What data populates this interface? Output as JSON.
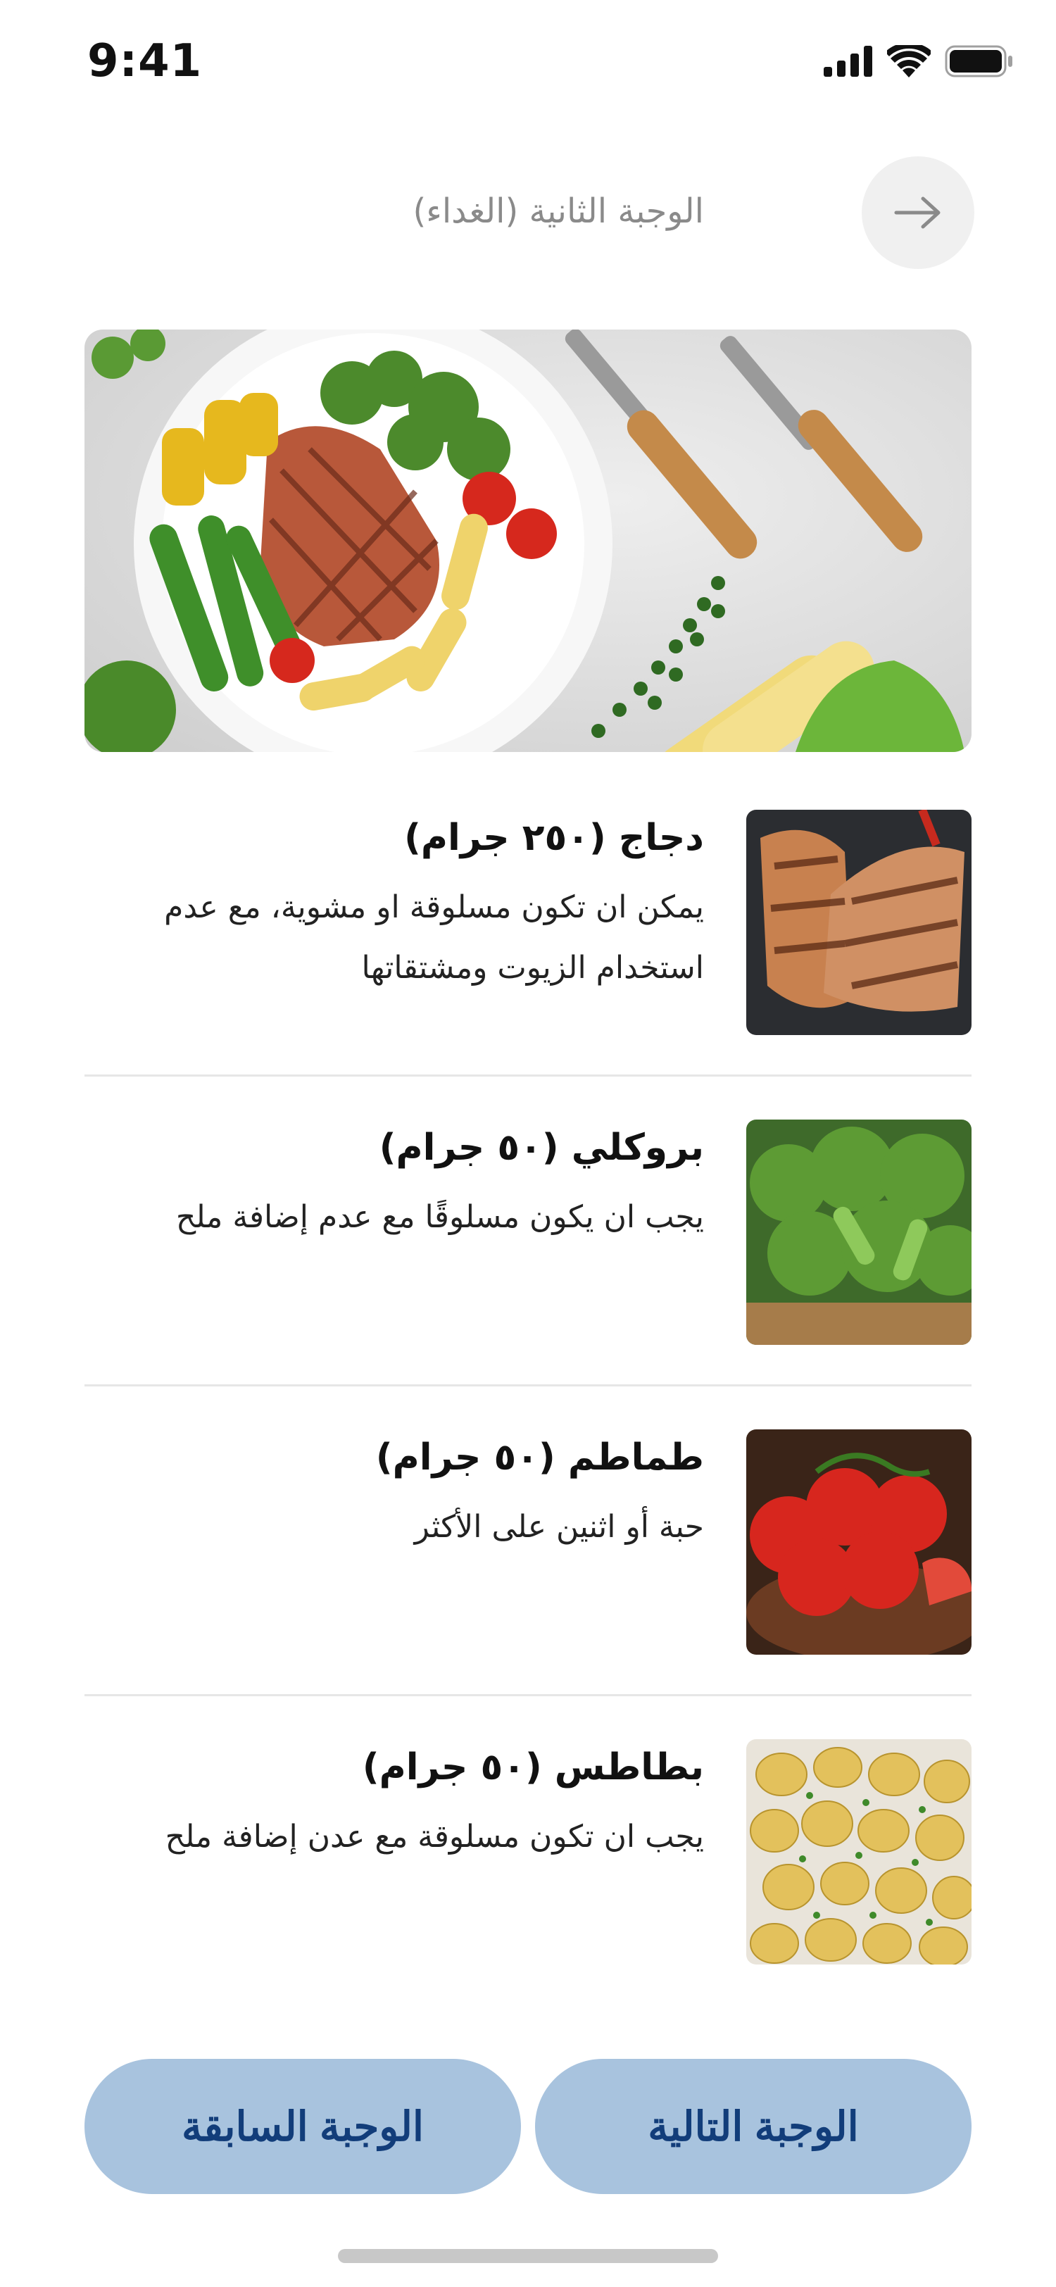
{
  "status_bar": {
    "time": "9:41"
  },
  "header": {
    "title": "الوجبة الثانية (الغداء)"
  },
  "food_items": [
    {
      "name": "دجاج (٢٥٠ جرام)",
      "description": "يمكن ان تكون مسلوقة او مشوية، مع عدم استخدام الزيوت ومشتقاتها"
    },
    {
      "name": "بروكلي (٥٠ جرام)",
      "description": "يجب ان يكون مسلوقًا مع عدم إضافة ملح"
    },
    {
      "name": "طماطم (٥٠ جرام)",
      "description": "حبة أو اثنين على الأكثر"
    },
    {
      "name": "بطاطس (٥٠ جرام)",
      "description": "يجب ان تكون مسلوقة مع عدن إضافة ملح"
    }
  ],
  "footer": {
    "next_label": "الوجبة التالية",
    "previous_label": "الوجبة السابقة"
  },
  "colors": {
    "button_bg": "#a8c3de",
    "button_text": "#123d7a"
  }
}
